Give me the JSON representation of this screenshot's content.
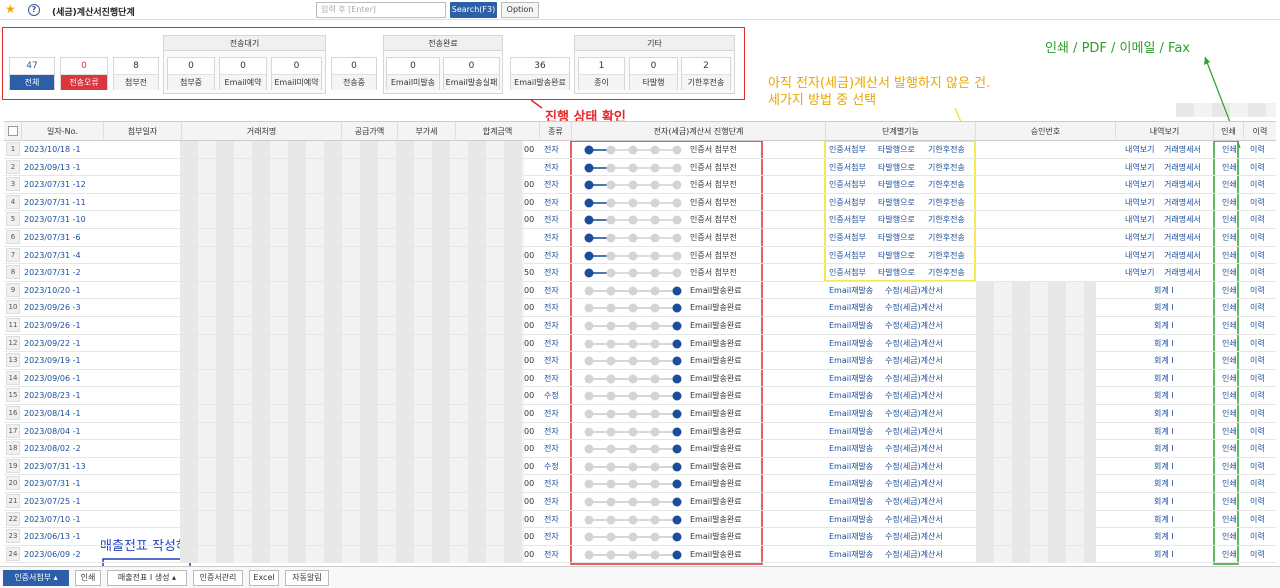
{
  "topbar": {
    "title": "(세금)계산서진행단계",
    "search_placeholder": "입력 후 [Enter]",
    "search_btn": "Search(F3)",
    "option_btn": "Option"
  },
  "status": {
    "total": {
      "num": "47",
      "label": "전체"
    },
    "error": {
      "num": "0",
      "label": "전송오류"
    },
    "before": {
      "num": "8",
      "label": "첨부전"
    },
    "wait_title": "전송대기",
    "wait": [
      {
        "num": "0",
        "label": "첨부중"
      },
      {
        "num": "0",
        "label": "Email예약"
      },
      {
        "num": "0",
        "label": "Email미예약"
      }
    ],
    "sending": {
      "num": "0",
      "label": "전송중"
    },
    "done_title": "전송완료",
    "done": [
      {
        "num": "0",
        "label": "Email미발송"
      },
      {
        "num": "0",
        "label": "Email발송실패"
      }
    ],
    "emaildone": {
      "num": "36",
      "label": "Email발송완료"
    },
    "etc_title": "기타",
    "etc": [
      {
        "num": "1",
        "label": "종이"
      },
      {
        "num": "0",
        "label": "타발행"
      },
      {
        "num": "2",
        "label": "기한후전송"
      }
    ]
  },
  "notes": {
    "print": "인쇄 / PDF / 이메일 / Fax",
    "unissued1": "아직 전자(세금)계산서 발행하지 않은 건.",
    "unissued2": "세가지 방법 중 선택",
    "progress": "진행 상태 확인",
    "noslip": "매출전표 작성하지 않은 경우"
  },
  "headers": {
    "date": "일자-No.",
    "attach": "첨부일자",
    "client": "거래처명",
    "supply": "공급가액",
    "vat": "부가세",
    "total": "합계금액",
    "type": "종류",
    "stage": "전자(세금)계산서 진행단계",
    "func": "단계별기능",
    "approval": "승인번호",
    "detail": "내역보기",
    "print": "인쇄",
    "history": "이력"
  },
  "rows": [
    {
      "no": "1",
      "date": "2023/10/18 -1",
      "amt": "00",
      "type": "전자",
      "step": 1,
      "status": "인증서 첨부전",
      "f1": "인증서첨부",
      "f2": "타발행으로",
      "f3": "기한후전송",
      "d1": "내역보기",
      "d2": "거래명세서",
      "pr": "인쇄",
      "hi": "이력"
    },
    {
      "no": "2",
      "date": "2023/09/13 -1",
      "amt": "",
      "type": "전자",
      "step": 1,
      "status": "인증서 첨부전",
      "f1": "인증서첨부",
      "f2": "타발행으로",
      "f3": "기한후전송",
      "d1": "내역보기",
      "d2": "거래명세서",
      "pr": "인쇄",
      "hi": "이력"
    },
    {
      "no": "3",
      "date": "2023/07/31 -12",
      "amt": "00",
      "type": "전자",
      "step": 1,
      "status": "인증서 첨부전",
      "f1": "인증서첨부",
      "f2": "타발행으로",
      "f3": "기한후전송",
      "d1": "내역보기",
      "d2": "거래명세서",
      "pr": "인쇄",
      "hi": "이력"
    },
    {
      "no": "4",
      "date": "2023/07/31 -11",
      "amt": "00",
      "type": "전자",
      "step": 1,
      "status": "인증서 첨부전",
      "f1": "인증서첨부",
      "f2": "타발행으로",
      "f3": "기한후전송",
      "d1": "내역보기",
      "d2": "거래명세서",
      "pr": "인쇄",
      "hi": "이력"
    },
    {
      "no": "5",
      "date": "2023/07/31 -10",
      "amt": "00",
      "type": "전자",
      "step": 1,
      "status": "인증서 첨부전",
      "f1": "인증서첨부",
      "f2": "타발행으로",
      "f3": "기한후전송",
      "d1": "내역보기",
      "d2": "거래명세서",
      "pr": "인쇄",
      "hi": "이력"
    },
    {
      "no": "6",
      "date": "2023/07/31 -6",
      "amt": "",
      "type": "전자",
      "step": 1,
      "status": "인증서 첨부전",
      "f1": "인증서첨부",
      "f2": "타발행으로",
      "f3": "기한후전송",
      "d1": "내역보기",
      "d2": "거래명세서",
      "pr": "인쇄",
      "hi": "이력"
    },
    {
      "no": "7",
      "date": "2023/07/31 -4",
      "amt": "00",
      "type": "전자",
      "step": 1,
      "status": "인증서 첨부전",
      "f1": "인증서첨부",
      "f2": "타발행으로",
      "f3": "기한후전송",
      "d1": "내역보기",
      "d2": "거래명세서",
      "pr": "인쇄",
      "hi": "이력"
    },
    {
      "no": "8",
      "date": "2023/07/31 -2",
      "amt": "50",
      "type": "전자",
      "step": 1,
      "status": "인증서 첨부전",
      "f1": "인증서첨부",
      "f2": "타발행으로",
      "f3": "기한후전송",
      "d1": "내역보기",
      "d2": "거래명세서",
      "pr": "인쇄",
      "hi": "이력"
    },
    {
      "no": "9",
      "date": "2023/10/20 -1",
      "amt": "00",
      "type": "전자",
      "step": 5,
      "status": "Email발송완료",
      "f1": "Email재발송",
      "f2": "수정(세금)계산서",
      "f3": "",
      "d1": "회계 I",
      "d2": "",
      "pr": "인쇄",
      "hi": "이력"
    },
    {
      "no": "10",
      "date": "2023/09/26 -3",
      "amt": "00",
      "type": "전자",
      "step": 5,
      "status": "Email발송완료",
      "f1": "Email재발송",
      "f2": "수정(세금)계산서",
      "f3": "",
      "d1": "회계 I",
      "d2": "",
      "pr": "인쇄",
      "hi": "이력"
    },
    {
      "no": "11",
      "date": "2023/09/26 -1",
      "amt": "00",
      "type": "전자",
      "step": 5,
      "status": "Email발송완료",
      "f1": "Email재발송",
      "f2": "수정(세금)계산서",
      "f3": "",
      "d1": "회계 I",
      "d2": "",
      "pr": "인쇄",
      "hi": "이력"
    },
    {
      "no": "12",
      "date": "2023/09/22 -1",
      "amt": "00",
      "type": "전자",
      "step": 5,
      "status": "Email발송완료",
      "f1": "Email재발송",
      "f2": "수정(세금)계산서",
      "f3": "",
      "d1": "회계 I",
      "d2": "",
      "pr": "인쇄",
      "hi": "이력"
    },
    {
      "no": "13",
      "date": "2023/09/19 -1",
      "amt": "00",
      "type": "전자",
      "step": 5,
      "status": "Email발송완료",
      "f1": "Email재발송",
      "f2": "수정(세금)계산서",
      "f3": "",
      "d1": "회계 I",
      "d2": "",
      "pr": "인쇄",
      "hi": "이력"
    },
    {
      "no": "14",
      "date": "2023/09/06 -1",
      "amt": "00",
      "type": "전자",
      "step": 5,
      "status": "Email발송완료",
      "f1": "Email재발송",
      "f2": "수정(세금)계산서",
      "f3": "",
      "d1": "회계 I",
      "d2": "",
      "pr": "인쇄",
      "hi": "이력"
    },
    {
      "no": "15",
      "date": "2023/08/23 -1",
      "amt": "00",
      "type": "수정",
      "step": 5,
      "status": "Email발송완료",
      "f1": "Email재발송",
      "f2": "수정(세금)계산서",
      "f3": "",
      "d1": "회계 I",
      "d2": "",
      "pr": "인쇄",
      "hi": "이력"
    },
    {
      "no": "16",
      "date": "2023/08/14 -1",
      "amt": "00",
      "type": "전자",
      "step": 5,
      "status": "Email발송완료",
      "f1": "Email재발송",
      "f2": "수정(세금)계산서",
      "f3": "",
      "d1": "회계 I",
      "d2": "",
      "pr": "인쇄",
      "hi": "이력"
    },
    {
      "no": "17",
      "date": "2023/08/04 -1",
      "amt": "00",
      "type": "전자",
      "step": 5,
      "status": "Email발송완료",
      "f1": "Email재발송",
      "f2": "수정(세금)계산서",
      "f3": "",
      "d1": "회계 I",
      "d2": "",
      "pr": "인쇄",
      "hi": "이력"
    },
    {
      "no": "18",
      "date": "2023/08/02 -2",
      "amt": "00",
      "type": "전자",
      "step": 5,
      "status": "Email발송완료",
      "f1": "Email재발송",
      "f2": "수정(세금)계산서",
      "f3": "",
      "d1": "회계 I",
      "d2": "",
      "pr": "인쇄",
      "hi": "이력"
    },
    {
      "no": "19",
      "date": "2023/07/31 -13",
      "amt": "00",
      "type": "수정",
      "step": 5,
      "status": "Email발송완료",
      "f1": "Email재발송",
      "f2": "수정(세금)계산서",
      "f3": "",
      "d1": "회계 I",
      "d2": "",
      "pr": "인쇄",
      "hi": "이력"
    },
    {
      "no": "20",
      "date": "2023/07/31 -1",
      "amt": "00",
      "type": "전자",
      "step": 5,
      "status": "Email발송완료",
      "f1": "Email재발송",
      "f2": "수정(세금)계산서",
      "f3": "",
      "d1": "회계 I",
      "d2": "",
      "pr": "인쇄",
      "hi": "이력"
    },
    {
      "no": "21",
      "date": "2023/07/25 -1",
      "amt": "00",
      "type": "전자",
      "step": 5,
      "status": "Email발송완료",
      "f1": "Email재발송",
      "f2": "수정(세금)계산서",
      "f3": "",
      "d1": "회계 I",
      "d2": "",
      "pr": "인쇄",
      "hi": "이력"
    },
    {
      "no": "22",
      "date": "2023/07/10 -1",
      "amt": "00",
      "type": "전자",
      "step": 5,
      "status": "Email발송완료",
      "f1": "Email재발송",
      "f2": "수정(세금)계산서",
      "f3": "",
      "d1": "회계 I",
      "d2": "",
      "pr": "인쇄",
      "hi": "이력"
    },
    {
      "no": "23",
      "date": "2023/06/13 -1",
      "amt": "00",
      "type": "전자",
      "step": 5,
      "status": "Email발송완료",
      "f1": "Email재발송",
      "f2": "수정(세금)계산서",
      "f3": "",
      "d1": "회계 I",
      "d2": "",
      "pr": "인쇄",
      "hi": "이력"
    },
    {
      "no": "24",
      "date": "2023/06/09 -2",
      "amt": "00",
      "type": "전자",
      "step": 5,
      "status": "Email발송완료",
      "f1": "Email재발송",
      "f2": "수정(세금)계산서",
      "f3": "",
      "d1": "회계 I",
      "d2": "",
      "pr": "인쇄",
      "hi": "이력"
    }
  ],
  "bottom": {
    "cert": "인증서첨부",
    "print": "인쇄",
    "slip": "매출전표 I 생성",
    "certmgmt": "인증서관리",
    "excel": "Excel",
    "auto": "자동알림"
  },
  "colors": {
    "accent": "#2c5fa8",
    "error": "#d9363e",
    "annotation_red": "#e2282d",
    "annotation_yellow": "#f2e21a",
    "annotation_green": "#2ca02c",
    "annotation_blue": "#1f3fbf",
    "dot_active": "#1a4d9a"
  }
}
